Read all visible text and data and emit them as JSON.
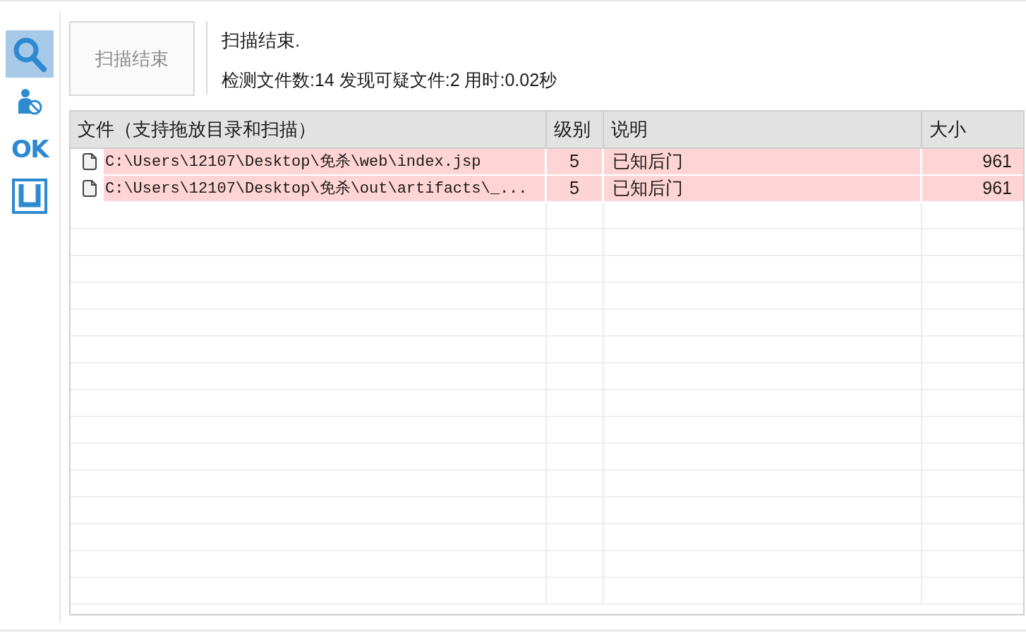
{
  "toolbar": [
    {
      "kind": "search",
      "selected": true
    },
    {
      "kind": "user-block",
      "selected": false
    },
    {
      "kind": "text",
      "label": "OK",
      "selected": false
    },
    {
      "kind": "frame",
      "selected": false
    }
  ],
  "scan_button": {
    "label": "扫描结束",
    "disabled": true
  },
  "status": {
    "title": "扫描结束.",
    "summary": "检测文件数:14 发现可疑文件:2 用时:0.02秒"
  },
  "table": {
    "columns": [
      {
        "kind": "file",
        "label": "文件（支持拖放目录和扫描）"
      },
      {
        "kind": "level",
        "label": "级别"
      },
      {
        "kind": "description",
        "label": "说明"
      },
      {
        "kind": "size",
        "label": "大小"
      }
    ],
    "rows": [
      {
        "file": "C:\\Users\\12107\\Desktop\\免杀\\web\\index.jsp",
        "level": "5",
        "description": "已知后门",
        "size": "961",
        "highlighted": true
      },
      {
        "file": "C:\\Users\\12107\\Desktop\\免杀\\out\\artifacts\\_...",
        "level": "5",
        "description": "已知后门",
        "size": "961",
        "highlighted": true
      }
    ]
  }
}
